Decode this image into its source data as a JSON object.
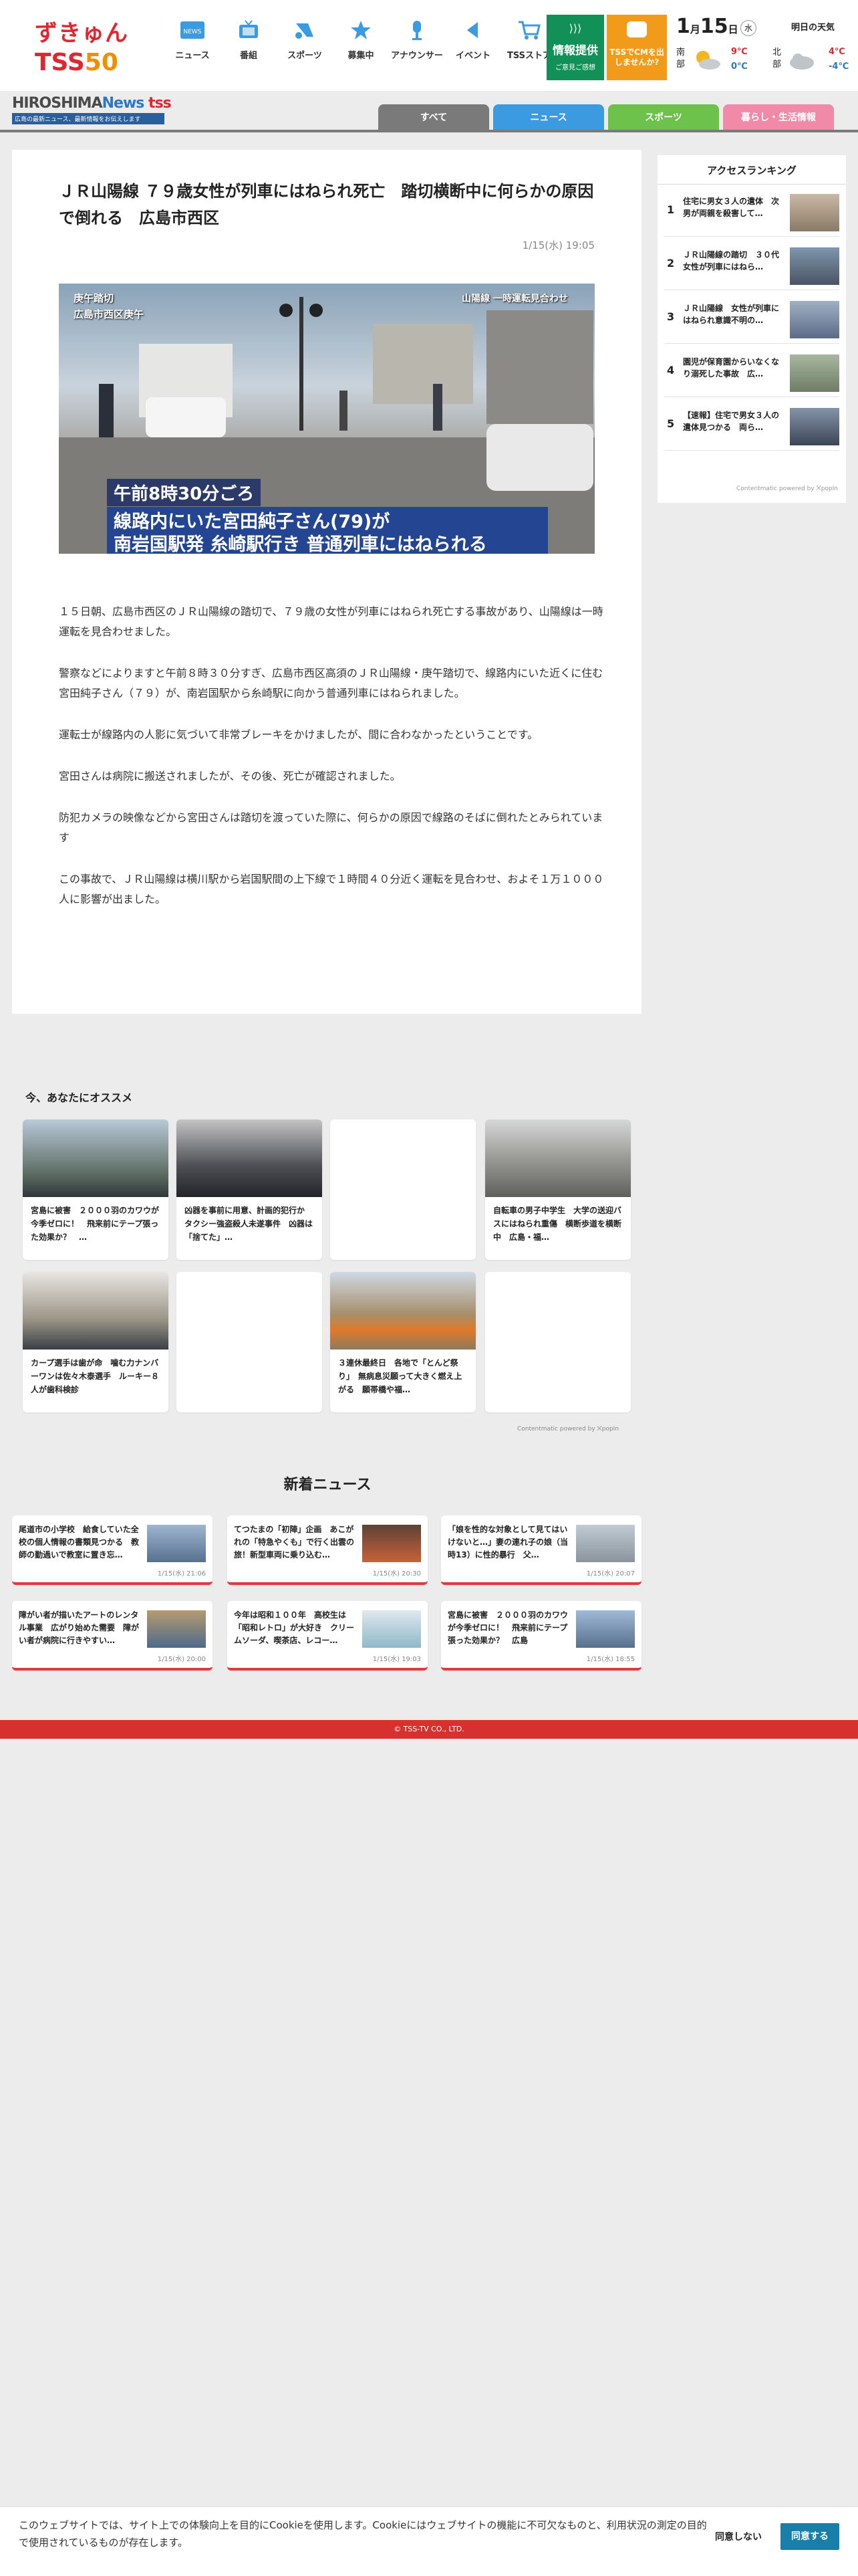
{
  "header": {
    "logo_top": "ずきゅん",
    "logo_bottom": "TSS",
    "logo_bottom_num": "50",
    "nav": [
      {
        "label": "ニュース",
        "icon": "news-icon"
      },
      {
        "label": "番組",
        "icon": "tv-icon"
      },
      {
        "label": "スポーツ",
        "icon": "sports-icon"
      },
      {
        "label": "募集中",
        "icon": "star-icon"
      },
      {
        "label": "アナウンサー",
        "icon": "microphone-icon"
      },
      {
        "label": "イベント",
        "icon": "flag-icon"
      },
      {
        "label": "TSSストア",
        "icon": "cart-icon"
      }
    ],
    "info_button": {
      "title": "情報提供",
      "sub": "ご意見ご感想"
    },
    "cm_button": {
      "text": "TSSでCMを出しませんか?"
    },
    "colors": {
      "info": "#119157",
      "cm": "#f29b1b",
      "brand_red": "#e0262f"
    }
  },
  "weather": {
    "month": "1",
    "month_unit": "月",
    "day": "15",
    "day_unit": "日",
    "dow": "水",
    "tomorrow_label": "明日の天気",
    "south": {
      "region": "南部",
      "high": "9℃",
      "low": "0℃"
    },
    "north": {
      "region": "北部",
      "high": "4℃",
      "low": "-4℃"
    }
  },
  "brand": {
    "name_a": "HIROSHIMA",
    "name_b": "News",
    "name_c": "tss",
    "sub": "広島の最新ニュース、最新情報をお伝えします"
  },
  "tabs": [
    {
      "label": "すべて",
      "color": "#7a7a7a"
    },
    {
      "label": "ニュース",
      "color": "#3c9be0"
    },
    {
      "label": "スポーツ",
      "color": "#6cc24a"
    },
    {
      "label": "暮らし・生活情報",
      "color": "#f08aa8"
    }
  ],
  "article": {
    "title": "ＪＲ山陽線 ７９歳女性が列車にはねられ死亡　踏切横断中に何らかの原因で倒れる　広島市西区",
    "date": "1/15(水) 19:05",
    "image_overlay_left": "庚午踏切\n広島市西区庚午",
    "image_overlay_right": "山陽線 一時運転見合わせ",
    "image_caption_time": "午前8時30分ごろ",
    "image_caption_main": "線路内にいた宮田純子さん(79)が\n南岩国駅発 糸崎駅行き 普通列車にはねられる",
    "paragraphs": [
      "１５日朝、広島市西区のＪＲ山陽線の踏切で、７９歳の女性が列車にはねられ死亡する事故があり、山陽線は一時運転を見合わせました。",
      "警察などによりますと午前８時３０分すぎ、広島市西区高須のＪＲ山陽線・庚午踏切で、線路内にいた近くに住む宮田純子さん（７９）が、南岩国駅から糸崎駅に向かう普通列車にはねられました。",
      "運転士が線路内の人影に気づいて非常ブレーキをかけましたが、間に合わなかったということです。",
      "宮田さんは病院に搬送されましたが、その後、死亡が確認されました。",
      "防犯カメラの映像などから宮田さんは踏切を渡っていた際に、何らかの原因で線路のそばに倒れたとみられています",
      "この事故で、ＪＲ山陽線は横川駅から岩国駅間の上下線で１時間４０分近く運転を見合わせ、およそ１万１０００人に影響が出ました。"
    ]
  },
  "ranking": {
    "title": "アクセスランキング",
    "items": [
      {
        "rank": "1",
        "text": "住宅に男女３人の遺体　次男が両親を殺害して…"
      },
      {
        "rank": "2",
        "text": "ＪＲ山陽線の踏切　３０代女性が列車にはねら…"
      },
      {
        "rank": "3",
        "text": "ＪＲ山陽線　女性が列車にはねられ意識不明の…"
      },
      {
        "rank": "4",
        "text": "園児が保育園からいなくなり溺死した事故　広…"
      },
      {
        "rank": "5",
        "text": "【速報】住宅で男女３人の遺体見つかる　両ら…"
      }
    ],
    "powered": "Contentmatic powered by ⨉popIn"
  },
  "recommend": {
    "title": "今、あなたにオススメ",
    "cards": [
      {
        "text": "宮島に被害　２０００羽のカワウが今季ゼロに！　飛来前にテープ張った効果か？　…"
      },
      {
        "text": "凶器を事前に用意、計画的犯行か　タクシー強盗殺人未遂事件　凶器は「捨てた」…"
      },
      {
        "text": ""
      },
      {
        "text": "自転車の男子中学生　大学の送迎バスにはねられ重傷　横断歩道を横断中　広島・福…"
      },
      {
        "text": "カープ選手は歯が命　噛む力ナンバーワンは佐々木泰選手　ルーキー８人が歯科検診"
      },
      {
        "text": ""
      },
      {
        "text": "３連休最終日　各地で「とんど祭り」　無病息災願って大きく燃え上がる　願帯橋や福…"
      },
      {
        "text": ""
      }
    ],
    "powered": "Contentmatic powered by ⨉popIn"
  },
  "new_news": {
    "title": "新着ニュース",
    "items": [
      {
        "text": "尾道市の小学校　給食していた全校の個人情報の書類見つかる　教師の勤過いで教室に置き忘…",
        "date": "1/15(水) 21:06"
      },
      {
        "text": "てつたまの「初陣」企画　あこがれの「特急やくも」で行く出雲の旅！新型車両に乗り込む…",
        "date": "1/15(水) 20:30"
      },
      {
        "text": "「娘を性的な対象として見てはいけないと…」妻の連れ子の娘（当時13）に性的暴行　父…",
        "date": "1/15(水) 20:07"
      },
      {
        "text": "障がい者が描いたアートのレンタル事業　広がり始めた需要　障がい者が病院に行きやすい…",
        "date": "1/15(水) 20:00"
      },
      {
        "text": "今年は昭和１００年　高校生は「昭和レトロ」が大好き　クリームソーダ、喫茶店、レコー…",
        "date": "1/15(水) 19:03"
      },
      {
        "text": "宮島に被害　２０００羽のカワウが今季ゼロに！　飛来前にテープ張った効果か？　広島",
        "date": "1/15(水) 18:55"
      }
    ]
  },
  "footer": {
    "copyright": "© TSS-TV CO., LTD."
  },
  "cookie": {
    "text": "このウェブサイトでは、サイト上での体験向上を目的にCookieを使用します。Cookieにはウェブサイトの機能に不可欠なものと、利用状況の測定の目的で使用されているものが存在します。",
    "deny": "同意しない",
    "agree": "同意する"
  }
}
